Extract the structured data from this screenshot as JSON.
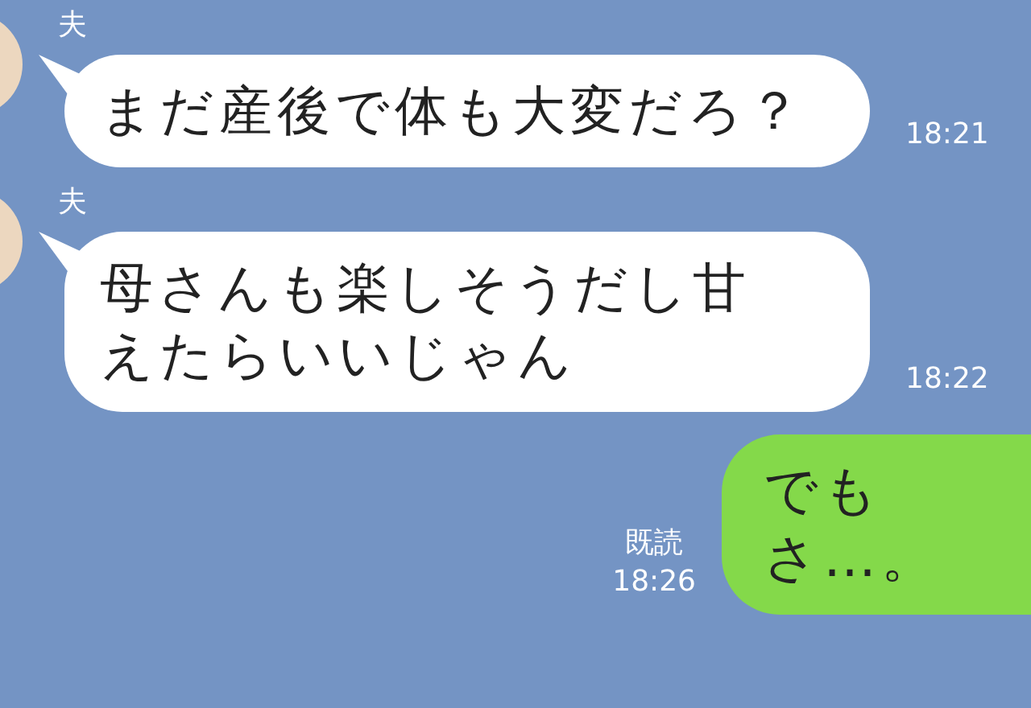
{
  "messages": [
    {
      "kind": "incoming",
      "sender": "夫",
      "text": "まだ産後で体も大変だろ？",
      "time": "18:21"
    },
    {
      "kind": "incoming",
      "sender": "夫",
      "text": "母さんも楽しそうだし甘えたらいいじゃん",
      "time": "18:22"
    },
    {
      "kind": "outgoing",
      "read": "既読",
      "text": "でもさ…。",
      "time": "18:26"
    }
  ]
}
